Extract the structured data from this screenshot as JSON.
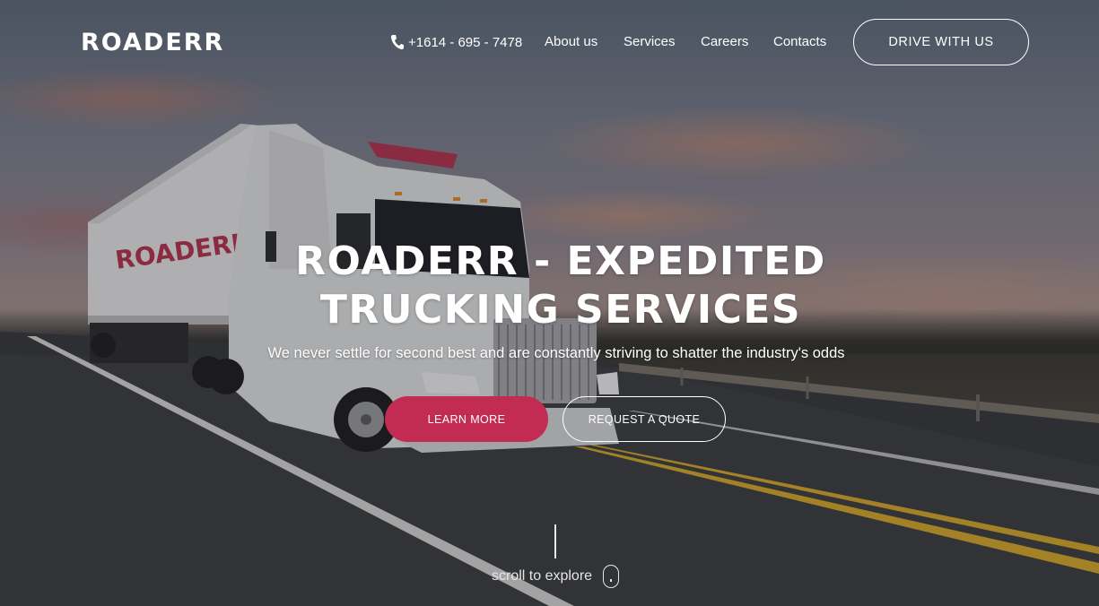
{
  "brand": {
    "logo": "ROADERR",
    "accent": "#c22b52"
  },
  "header": {
    "phone": "+1614 - 695 - 7478",
    "phone_icon": "phone-icon",
    "nav": [
      {
        "label": "About us"
      },
      {
        "label": "Services"
      },
      {
        "label": "Careers"
      },
      {
        "label": "Contacts"
      }
    ],
    "cta": "DRIVE WITH US"
  },
  "hero": {
    "title_line1": "ROADERR - EXPEDITED",
    "title_line2": "TRUCKING SERVICES",
    "subtitle": "We never settle for second best and are constantly striving to shatter the industry's odds",
    "primary_button": "LEARN MORE",
    "secondary_button": "REQUEST A QUOTE"
  },
  "scroll": {
    "text": "scroll to explore",
    "icon": "mouse-icon"
  }
}
